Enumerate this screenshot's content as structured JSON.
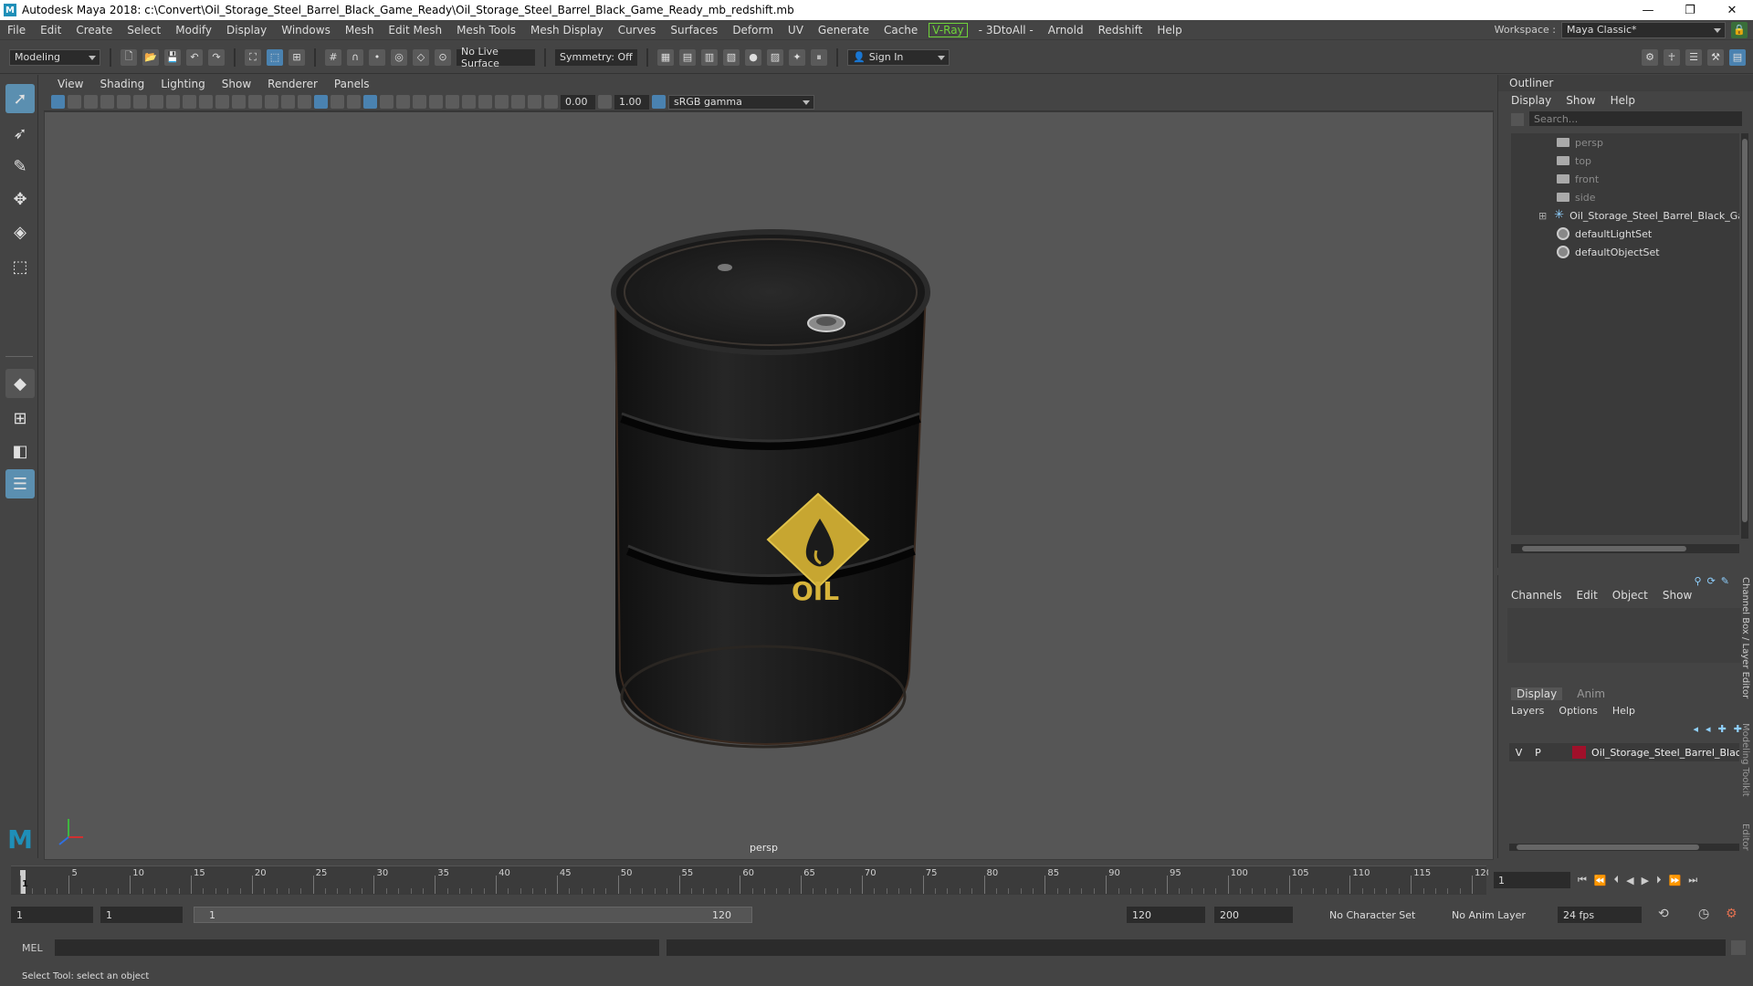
{
  "window": {
    "title": "Autodesk Maya 2018: c:\\Convert\\Oil_Storage_Steel_Barrel_Black_Game_Ready\\Oil_Storage_Steel_Barrel_Black_Game_Ready_mb_redshift.mb",
    "logo": "M"
  },
  "menubar": {
    "items": [
      "File",
      "Edit",
      "Create",
      "Select",
      "Modify",
      "Display",
      "Windows",
      "Mesh",
      "Edit Mesh",
      "Mesh Tools",
      "Mesh Display",
      "Curves",
      "Surfaces",
      "Deform",
      "UV",
      "Generate",
      "Cache"
    ],
    "vray": "V-Ray",
    "items2": [
      "- 3DtoAll -",
      "Arnold",
      "Redshift",
      "Help"
    ],
    "workspace_label": "Workspace :",
    "workspace_value": "Maya Classic*"
  },
  "statusline": {
    "mode": "Modeling",
    "live_surface": "No Live Surface",
    "symmetry": "Symmetry: Off",
    "sign_in": "Sign In"
  },
  "viewport": {
    "menu": [
      "View",
      "Shading",
      "Lighting",
      "Show",
      "Renderer",
      "Panels"
    ],
    "exposure": "0.00",
    "gamma": "1.00",
    "colorspace": "sRGB gamma",
    "camera": "persp",
    "barrel_label": "OIL"
  },
  "outliner": {
    "title": "Outliner",
    "menu": [
      "Display",
      "Show",
      "Help"
    ],
    "search_placeholder": "Search...",
    "items": [
      {
        "label": "persp",
        "dim": true
      },
      {
        "label": "top",
        "dim": true
      },
      {
        "label": "front",
        "dim": true
      },
      {
        "label": "side",
        "dim": true
      },
      {
        "label": "Oil_Storage_Steel_Barrel_Black_Game_Re",
        "dim": false
      },
      {
        "label": "defaultLightSet",
        "dim": false
      },
      {
        "label": "defaultObjectSet",
        "dim": false
      }
    ]
  },
  "channelbox": {
    "menu": [
      "Channels",
      "Edit",
      "Object",
      "Show"
    ],
    "tabs": [
      "Display",
      "Anim"
    ],
    "layer_menu": [
      "Layers",
      "Options",
      "Help"
    ],
    "layer": {
      "v": "V",
      "p": "P",
      "name": "Oil_Storage_Steel_Barrel_Black",
      "color": "#a0102a"
    },
    "side_tabs": [
      "Channel Box / Layer Editor",
      "Modeling Toolkit",
      "Attribute Editor"
    ]
  },
  "timeline": {
    "ticks": [
      "1",
      "5",
      "10",
      "15",
      "20",
      "25",
      "30",
      "35",
      "40",
      "45",
      "50",
      "55",
      "60",
      "65",
      "70",
      "75",
      "80",
      "85",
      "90",
      "95",
      "100",
      "105",
      "110",
      "115",
      "120"
    ],
    "current_frame": "1"
  },
  "range": {
    "start": "1",
    "playback_start": "1",
    "slider_start": "1",
    "slider_end": "120",
    "playback_end": "120",
    "end": "200",
    "character_set": "No Character Set",
    "anim_layer": "No Anim Layer",
    "fps": "24 fps"
  },
  "cmdline": {
    "label": "MEL"
  },
  "helpline": {
    "text": "Select Tool: select an object"
  }
}
